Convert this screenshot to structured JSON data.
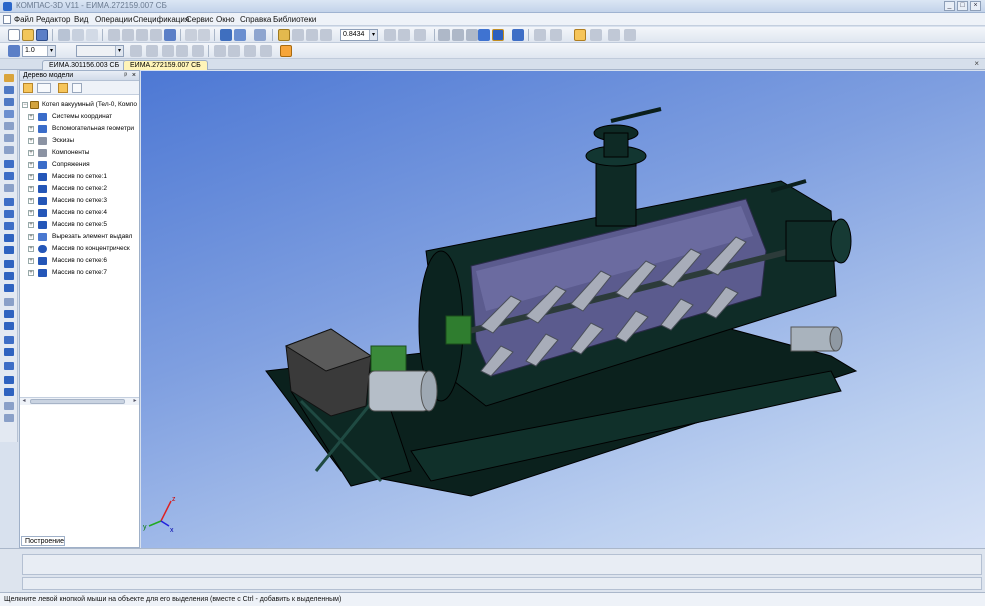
{
  "window": {
    "title": "КОМПАС-3D V11 - ЕИМА.272159.007 СБ",
    "minimize": "_",
    "maximize": "□",
    "close": "×"
  },
  "menu": [
    "Файл",
    "Редактор",
    "Вид",
    "Операции",
    "Спецификация",
    "Сервис",
    "Окно",
    "Справка",
    "Библиотеки"
  ],
  "toolbar2": {
    "scale_value": "1.0",
    "zoom_value": "0.8434"
  },
  "doc_tabs": [
    {
      "label": "ЕИМА.301156.003 СБ",
      "active": false
    },
    {
      "label": "ЕИМА.272159.007 СБ",
      "active": true
    }
  ],
  "tab_close": "×",
  "model_tree": {
    "header": "Дерево модели",
    "pin": "ᵖ",
    "close": "×",
    "root": "Котел вакуумный (Тел-0, Компо",
    "items": [
      {
        "label": "Системы координат",
        "icon": "blue"
      },
      {
        "label": "Вспомогательная геометри",
        "icon": "blue"
      },
      {
        "label": "Эскизы",
        "icon": "gray"
      },
      {
        "label": "Компоненты",
        "icon": "gray"
      },
      {
        "label": "Сопряжения",
        "icon": "blue"
      },
      {
        "label": "Массив по сетке:1",
        "icon": "grid"
      },
      {
        "label": "Массив по сетке:2",
        "icon": "grid"
      },
      {
        "label": "Массив по сетке:3",
        "icon": "grid"
      },
      {
        "label": "Массив по сетке:4",
        "icon": "grid"
      },
      {
        "label": "Массив по сетке:5",
        "icon": "grid"
      },
      {
        "label": "Вырезать элемент выдавл",
        "icon": "cut"
      },
      {
        "label": "Массив по концентрическ",
        "icon": "grid"
      },
      {
        "label": "Массив по сетке:6",
        "icon": "grid"
      },
      {
        "label": "Массив по сетке:7",
        "icon": "grid"
      }
    ],
    "bottom_tab": "Построение"
  },
  "viewport": {
    "axis_labels": [
      "x",
      "y",
      "z"
    ]
  },
  "status_text": "Щелкните левой кнопкой мыши на объекте для его выделения (вместе с Ctrl - добавить к выделенным)",
  "colors": {
    "accent": "#f6c55a",
    "frame": "#0d2621",
    "tank": "#12302b",
    "inner": "#5a5a8c"
  }
}
